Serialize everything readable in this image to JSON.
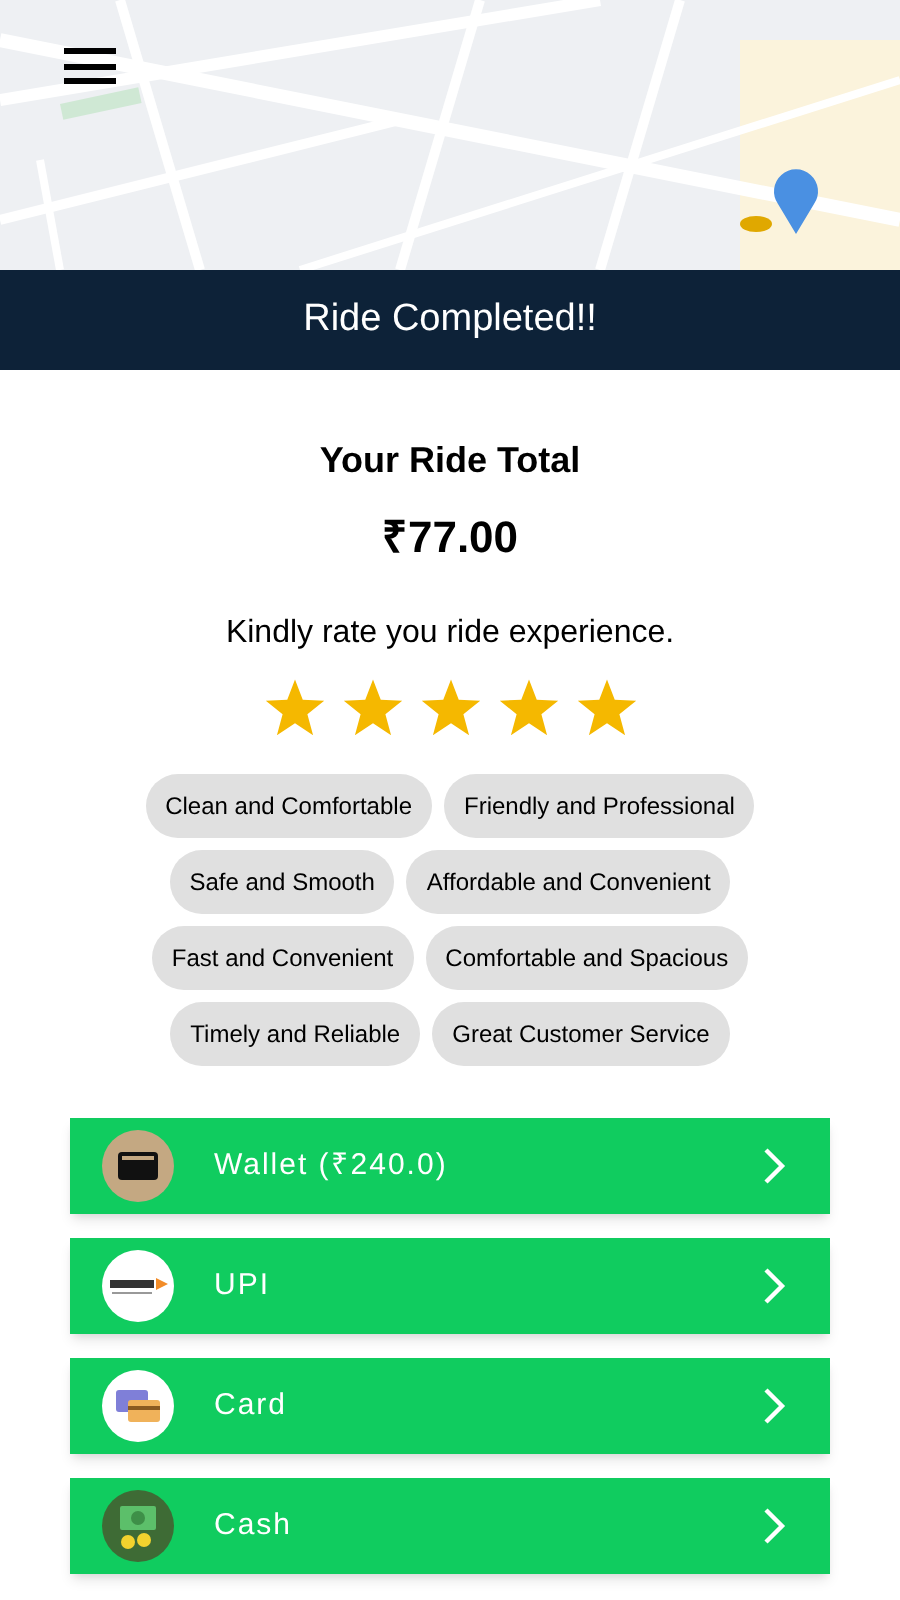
{
  "header": {
    "title": "Ride Completed!!"
  },
  "total": {
    "label": "Your Ride Total",
    "amount": "₹77.00"
  },
  "rating": {
    "prompt": "Kindly rate you ride experience.",
    "stars": 5
  },
  "tags": [
    [
      "Clean and Comfortable",
      "Friendly and Professional"
    ],
    [
      "Safe and Smooth",
      "Affordable and Convenient"
    ],
    [
      "Fast and Convenient",
      "Comfortable and Spacious"
    ],
    [
      "Timely and Reliable",
      "Great Customer Service"
    ]
  ],
  "payment_methods": [
    {
      "kind": "wallet",
      "label": "Wallet (₹240.0)"
    },
    {
      "kind": "upi",
      "label": "UPI"
    },
    {
      "kind": "card",
      "label": "Card"
    },
    {
      "kind": "cash",
      "label": "Cash"
    }
  ]
}
